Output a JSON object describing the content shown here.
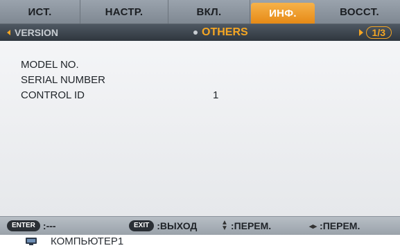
{
  "tabs": [
    {
      "label": "ИСТ.",
      "active": false
    },
    {
      "label": "НАСТР.",
      "active": false
    },
    {
      "label": "ВКЛ.",
      "active": false
    },
    {
      "label": "ИНФ.",
      "active": true
    },
    {
      "label": "ВОССТ.",
      "active": false
    }
  ],
  "subheader": {
    "prev_label": "VERSION",
    "current_label": "OTHERS",
    "page": "1/3"
  },
  "info_rows": [
    {
      "label": "MODEL NO.",
      "value": ""
    },
    {
      "label": "SERIAL NUMBER",
      "value": ""
    },
    {
      "label": "CONTROL ID",
      "value": "1"
    }
  ],
  "footer": {
    "enter_key": "ENTER",
    "enter_action": ":---",
    "exit_key": "EXIT",
    "exit_action": ":ВЫХОД",
    "updown_action": ":ПЕРЕМ.",
    "leftright_action": ":ПЕРЕМ."
  },
  "source": {
    "label": "КОМПЬЮТЕР1",
    "icon": "computer-monitor-icon"
  },
  "colors": {
    "active_tab": "#f09a24",
    "accent": "#f5a623",
    "tab_bar": "#8a929b",
    "subheader_bg": "#3b434b"
  }
}
